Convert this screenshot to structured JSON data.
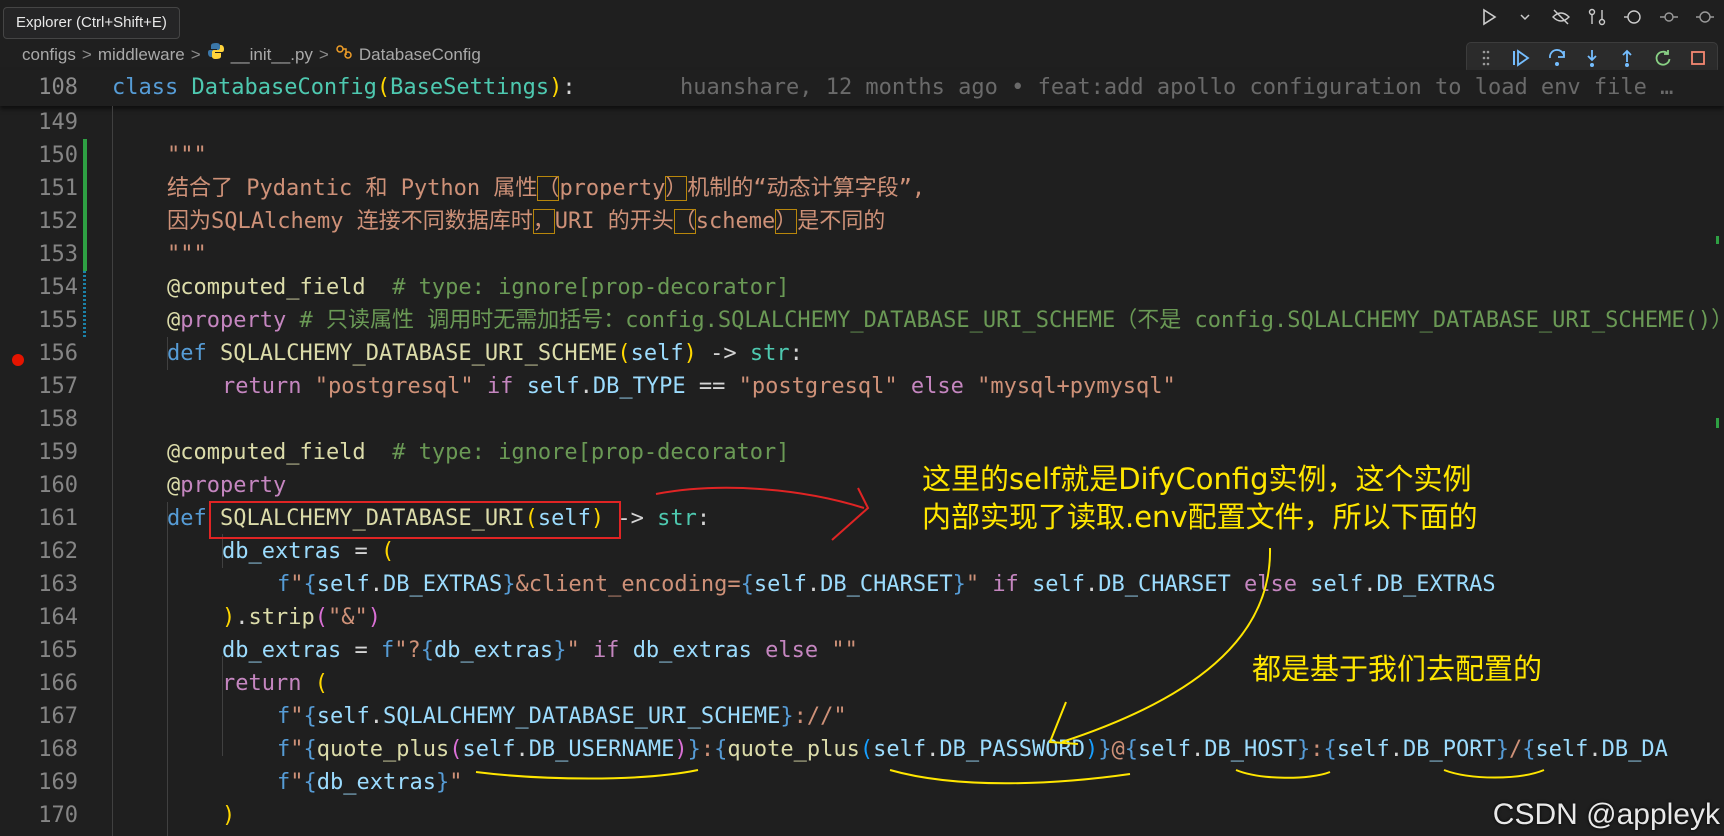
{
  "tooltip": "Explorer (Ctrl+Shift+E)",
  "breadcrumb": {
    "items": [
      "configs",
      "middleware",
      "__init__.py",
      "DatabaseConfig"
    ],
    "separator": ">"
  },
  "toolbar_icons": [
    "run-icon",
    "run-dropdown-icon",
    "eye-off-icon",
    "compare-icon",
    "history-icon",
    "commit-icon",
    "more-icon"
  ],
  "debug_toolbar": [
    "drag-handle-icon",
    "continue-icon",
    "step-over-icon",
    "step-into-icon",
    "step-out-icon",
    "restart-icon",
    "stop-icon"
  ],
  "sticky": {
    "line": "108",
    "kw": "class",
    "name": "DatabaseConfig",
    "base": "BaseSettings",
    "blame": "huanshare, 12 months ago • feat:add apollo configuration to load env file …"
  },
  "lines": {
    "l149": "149",
    "l150": "150",
    "l151": "151",
    "l152": "152",
    "l153": "153",
    "l154": "154",
    "l155": "155",
    "l156": "156",
    "l157": "157",
    "l158": "158",
    "l159": "159",
    "l160": "160",
    "l161": "161",
    "l162": "162",
    "l163": "163",
    "l164": "164",
    "l165": "165",
    "l166": "166",
    "l167": "167",
    "l168": "168",
    "l169": "169",
    "l170": "170"
  },
  "code": {
    "docq": "\"\"\"",
    "doc1a": "结合了 Pydantic 和 Python 属性",
    "doc1b": "（",
    "doc1c": "property",
    "doc1d": "）",
    "doc1e": "机制的“动态计算字段”,",
    "doc2a": "因为SQLAlchemy 连接不同数据库时",
    "doc2b": "，",
    "doc2c": "URI 的开头",
    "doc2d": "（",
    "doc2e": "scheme",
    "doc2f": "）",
    "doc2g": "是不同的",
    "computed_field": "@computed_field",
    "ignore_comment": "# type: ignore[prop-decorator]",
    "at": "@",
    "property": "property",
    "prop_comment": "# 只读属性 调用时无需加括号：config.SQLALCHEMY_DATABASE_URI_SCHEME（不是 config.SQLALCHEMY_DATABASE_URI_SCHEME()）",
    "def": "def",
    "scheme_fn": "SQLALCHEMY_DATABASE_URI_SCHEME",
    "self": "self",
    "arrow": "->",
    "str": "str",
    "return": "return",
    "pg": "\"postgresql\"",
    "if": "if",
    "else": "else",
    "db_type": "DB_TYPE",
    "mysql": "\"mysql+pymysql\"",
    "uri_fn": "SQLALCHEMY_DATABASE_URI",
    "db_extras": "db_extras",
    "db_extras_attr": "DB_EXTRAS",
    "client_enc": "&client_encoding=",
    "db_charset": "DB_CHARSET",
    "strip": "strip",
    "amp": "\"&\"",
    "qmark": "?",
    "empty": "\"\"",
    "scheme_sep": "://",
    "quote_plus": "quote_plus",
    "db_username": "DB_USERNAME",
    "db_password": "DB_PASSWORD",
    "db_host": "DB_HOST",
    "db_port": "DB_PORT",
    "db_da": "DB_DA"
  },
  "annotations": {
    "note1_line1": "这里的self就是DifyConfig实例，这个实例",
    "note1_line2": "内部实现了读取.env配置文件，所以下面的",
    "note2": "都是基于我们去配置的"
  },
  "watermark": "CSDN @appleyk",
  "colors": {
    "background": "#1f1f1f",
    "keyword": "#569cd6",
    "string": "#ce9178",
    "comment": "#6a9955",
    "annotation": "#ffe600",
    "annotation_box": "#e02424"
  }
}
